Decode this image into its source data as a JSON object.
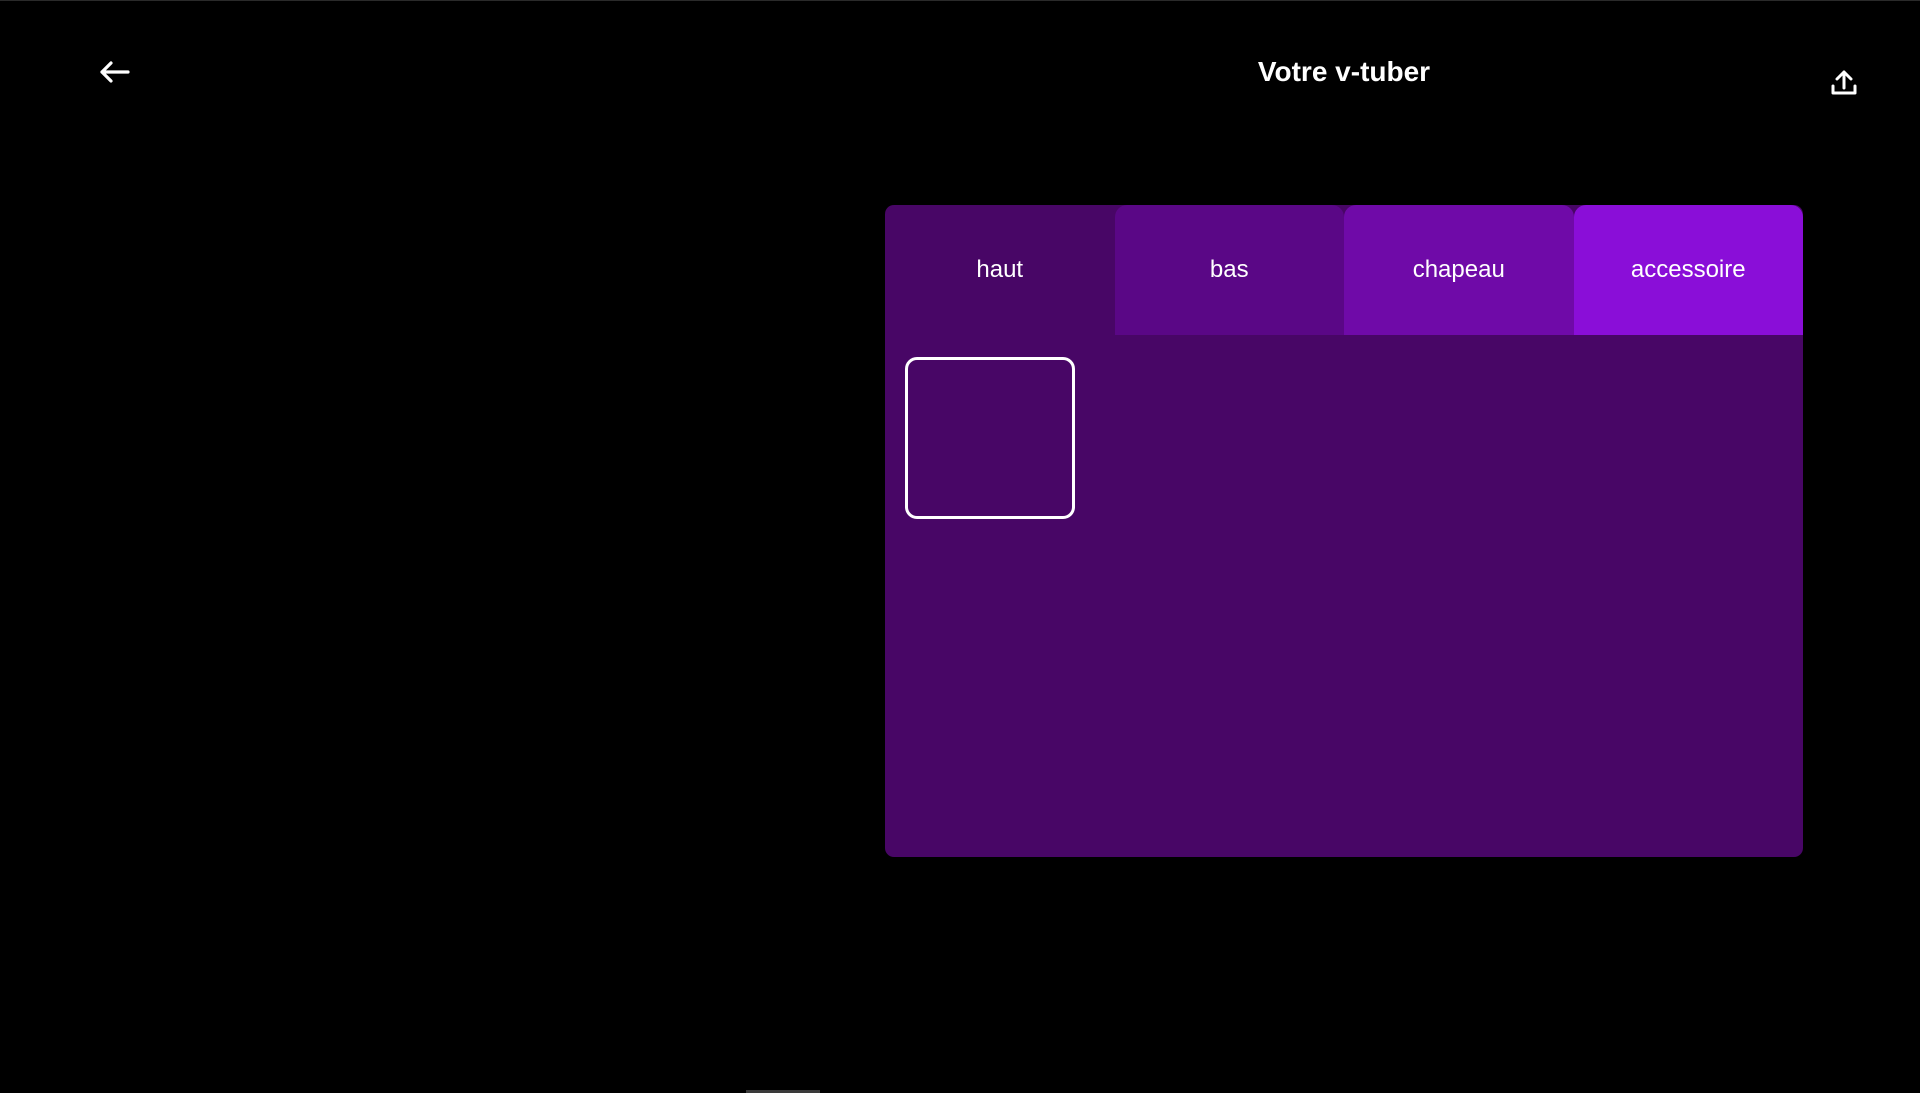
{
  "header": {
    "title": "Votre v-tuber",
    "back_icon": "arrow-left-icon",
    "export_icon": "upload-icon"
  },
  "tabs": [
    {
      "label": "haut",
      "color": "#480666",
      "active": true
    },
    {
      "label": "bas",
      "color": "#5a0786"
    },
    {
      "label": "chapeau",
      "color": "#6f0aa8"
    },
    {
      "label": "accessoire",
      "color": "#8a0ed8"
    }
  ],
  "panel": {
    "background": "#480666",
    "item_count": 1
  }
}
